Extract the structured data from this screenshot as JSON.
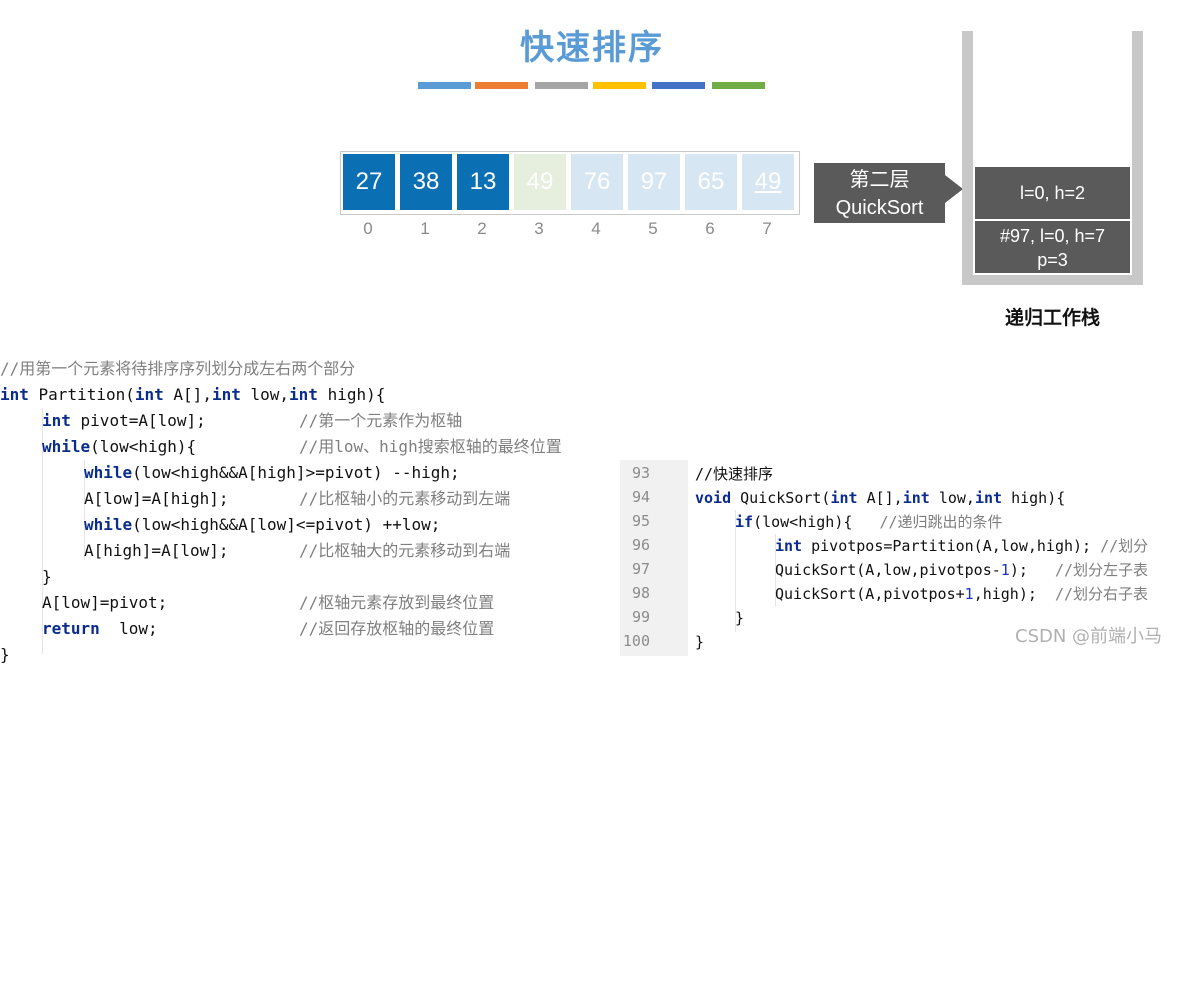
{
  "title": "快速排序",
  "color_bars": [
    "#5b9bd5",
    "#ed7d31",
    "#a5a5a5",
    "#ffc000",
    "#4472c4",
    "#70ad47"
  ],
  "array": {
    "cells": [
      {
        "value": "27",
        "index": "0",
        "state": "active"
      },
      {
        "value": "38",
        "index": "1",
        "state": "active"
      },
      {
        "value": "13",
        "index": "2",
        "state": "active"
      },
      {
        "value": "49",
        "index": "3",
        "state": "pivot-done"
      },
      {
        "value": "76",
        "index": "4",
        "state": "inactive"
      },
      {
        "value": "97",
        "index": "5",
        "state": "inactive"
      },
      {
        "value": "65",
        "index": "6",
        "state": "inactive"
      },
      {
        "value": "49",
        "index": "7",
        "state": "inactive-underlined"
      }
    ],
    "colors": {
      "active": "#0b6fb3",
      "pivot-done": "#e6eedd",
      "inactive": "#d6e6f3"
    }
  },
  "layer_label": {
    "line1": "第二层",
    "line2": "QuickSort"
  },
  "stack": {
    "label": "递归工作栈",
    "frames": [
      {
        "line1": "l=0, h=2",
        "line2": ""
      },
      {
        "line1": "#97, l=0, h=7",
        "line2": "p=3"
      }
    ]
  },
  "partition_code": {
    "comment_header": "//用第一个元素将待排序序列划分成左右两个部分",
    "lines": [
      {
        "kw": "int",
        "text": " Partition(",
        "kw2": "int",
        "text2": " A[],",
        "kw3": "int",
        "text3": " low,",
        "kw4": "int",
        "text4": " high){"
      },
      {
        "kw": "int",
        "text": " pivot=A[low];",
        "comment": "//第一个元素作为枢轴"
      },
      {
        "kw": "while",
        "text": "(low<high){",
        "comment": "//用low、high搜索枢轴的最终位置"
      },
      {
        "kw": "while",
        "text": "(low<high&&A[high]>=pivot) --high;"
      },
      {
        "text": "A[low]=A[high];",
        "comment": "//比枢轴小的元素移动到左端"
      },
      {
        "kw": "while",
        "text": "(low<high&&A[low]<=pivot) ++low;"
      },
      {
        "text": "A[high]=A[low];",
        "comment": "//比枢轴大的元素移动到右端"
      },
      {
        "text": "}"
      },
      {
        "text": "A[low]=pivot;",
        "comment": "//枢轴元素存放到最终位置"
      },
      {
        "kw": "return",
        "text": "  low;",
        "comment": "//返回存放枢轴的最终位置"
      },
      {
        "text": "}"
      }
    ]
  },
  "quicksort_code": {
    "line_numbers": [
      "93",
      "94",
      "95",
      "96",
      "97",
      "98",
      "99",
      "100"
    ],
    "lines": [
      {
        "comment": "//快速排序"
      },
      {
        "kw": "void",
        "text": " QuickSort(",
        "kw2": "int",
        "text2": " A[],",
        "kw3": "int",
        "text3": " low,",
        "kw4": "int",
        "text4": " high){"
      },
      {
        "kw": "if",
        "text": "(low<high){   ",
        "comment": "//递归跳出的条件"
      },
      {
        "kw": "int",
        "text": " pivotpos=Partition(A,low,high); ",
        "comment": "//划分"
      },
      {
        "text": "QuickSort(A,low,pivotpos-",
        "num": "1",
        "text2": ");   ",
        "comment": "//划分左子表"
      },
      {
        "text": "QuickSort(A,pivotpos+",
        "num": "1",
        "text2": ",high);  ",
        "comment": "//划分右子表"
      },
      {
        "text": "}"
      },
      {
        "text": "}"
      }
    ]
  },
  "watermark": "CSDN @前端小马"
}
